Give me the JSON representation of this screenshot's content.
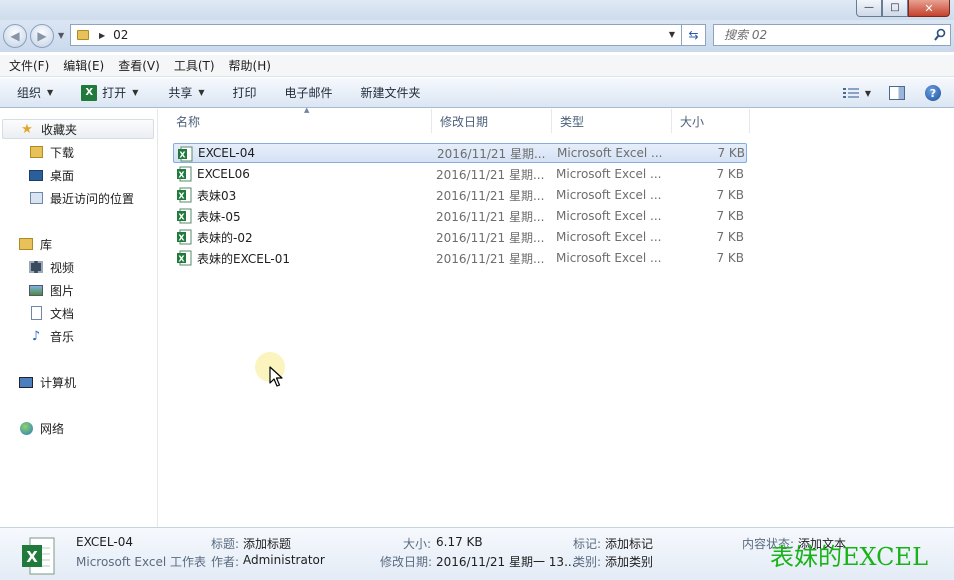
{
  "address": {
    "path": "02"
  },
  "search": {
    "placeholder": "搜索 02"
  },
  "menu": [
    "文件(F)",
    "编辑(E)",
    "查看(V)",
    "工具(T)",
    "帮助(H)"
  ],
  "toolbar": {
    "organize": "组织",
    "open": "打开",
    "share": "共享",
    "print": "打印",
    "email": "电子邮件",
    "new_folder": "新建文件夹"
  },
  "nav": {
    "favorites": "收藏夹",
    "downloads": "下载",
    "desktop": "桌面",
    "recent": "最近访问的位置",
    "libraries": "库",
    "videos": "视频",
    "pictures": "图片",
    "documents": "文档",
    "music": "音乐",
    "computer": "计算机",
    "network": "网络"
  },
  "columns": {
    "name": "名称",
    "date": "修改日期",
    "type": "类型",
    "size": "大小"
  },
  "files": [
    {
      "name": "EXCEL-04",
      "date": "2016/11/21 星期...",
      "type": "Microsoft Excel ...",
      "size": "7 KB"
    },
    {
      "name": "EXCEL06",
      "date": "2016/11/21 星期...",
      "type": "Microsoft Excel ...",
      "size": "7 KB"
    },
    {
      "name": "表妹03",
      "date": "2016/11/21 星期...",
      "type": "Microsoft Excel ...",
      "size": "7 KB"
    },
    {
      "name": "表妹-05",
      "date": "2016/11/21 星期...",
      "type": "Microsoft Excel ...",
      "size": "7 KB"
    },
    {
      "name": "表妹的-02",
      "date": "2016/11/21 星期...",
      "type": "Microsoft Excel ...",
      "size": "7 KB"
    },
    {
      "name": "表妹的EXCEL-01",
      "date": "2016/11/21 星期...",
      "type": "Microsoft Excel ...",
      "size": "7 KB"
    }
  ],
  "details": {
    "name": "EXCEL-04",
    "kind": "Microsoft Excel 工作表",
    "title_label": "标题:",
    "title_value": "添加标题",
    "author_label": "作者:",
    "author_value": "Administrator",
    "size_label": "大小:",
    "size_value": "6.17 KB",
    "modified_label": "修改日期:",
    "modified_value": "2016/11/21 星期一 13...",
    "tags_label": "标记:",
    "tags_value": "添加标记",
    "category_label": "类别:",
    "category_value": "添加类别",
    "content_label": "内容状态:",
    "content_value": "添加文本"
  },
  "watermark": "表妹的EXCEL",
  "colors": {
    "selection": "#d5e2f5",
    "excel_green": "#1f7a3c",
    "watermark": "#19b319"
  }
}
